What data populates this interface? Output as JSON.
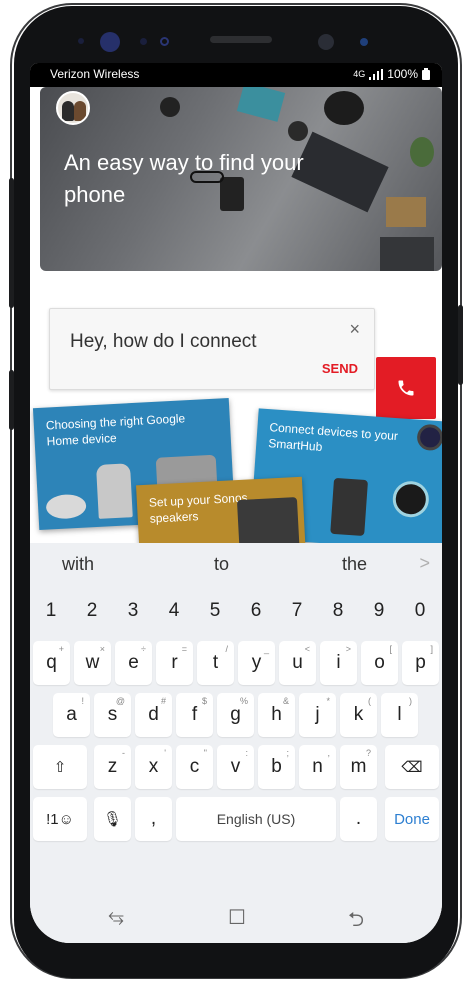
{
  "status_bar": {
    "carrier": "Verizon Wireless",
    "network": "4G",
    "battery": "100%"
  },
  "hero": {
    "title": "An easy way to find your phone"
  },
  "chat": {
    "input_text": "Hey, how do I connect",
    "close_symbol": "×",
    "send_label": "SEND"
  },
  "tiles": {
    "google_home": "Choosing the right Google Home device",
    "sonos": "Set up your Sonos speakers",
    "smarthub": "Connect devices to your SmartHub"
  },
  "keyboard": {
    "suggestions": [
      "with",
      "to",
      "the"
    ],
    "suggestion_arrow": ">",
    "number_row": [
      "1",
      "2",
      "3",
      "4",
      "5",
      "6",
      "7",
      "8",
      "9",
      "0"
    ],
    "row1": [
      "q",
      "w",
      "e",
      "r",
      "t",
      "y",
      "u",
      "i",
      "o",
      "p"
    ],
    "row1_hints": [
      "+",
      "×",
      "÷",
      "=",
      "/",
      "_",
      "<",
      ">",
      "[",
      "]"
    ],
    "row2": [
      "a",
      "s",
      "d",
      "f",
      "g",
      "h",
      "j",
      "k",
      "l"
    ],
    "row2_hints": [
      "!",
      "@",
      "#",
      "$",
      "%",
      "&",
      "*",
      "(",
      ")"
    ],
    "row3": [
      "z",
      "x",
      "c",
      "v",
      "b",
      "n",
      "m"
    ],
    "row3_hints": [
      "-",
      "'",
      "\"",
      ":",
      ";",
      ",",
      "?"
    ],
    "shift_symbol": "⇧",
    "backspace_symbol": "⌫",
    "symbols_label": "!1☺",
    "mic_symbol": "🎙",
    "comma": ",",
    "space_label": "English (US)",
    "period": ".",
    "done_label": "Done"
  },
  "navbar": {
    "recents_symbol": "⥃",
    "home_symbol": "☐",
    "back_symbol": "⮌"
  },
  "colors": {
    "accent_red": "#e31c25",
    "done_blue": "#2d7fd1"
  },
  "icons": [
    "phone-icon",
    "close-icon",
    "shift-icon",
    "backspace-icon",
    "mic-icon",
    "signal-icon",
    "battery-icon",
    "avatar"
  ]
}
